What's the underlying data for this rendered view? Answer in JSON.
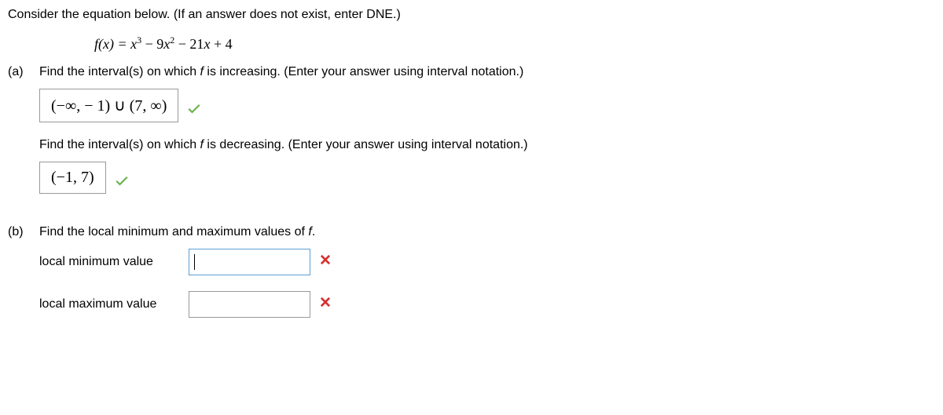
{
  "intro": "Consider the equation below. (If an answer does not exist, enter DNE.)",
  "equation": {
    "lhs": "f(x) = ",
    "rhs_html": "x<sup>3</sup> − 9x<sup>2</sup> − 21x + 4"
  },
  "parts": {
    "a": {
      "label": "(a)",
      "q1": "Find the interval(s) on which f is increasing. (Enter your answer using interval notation.)",
      "ans1": "(−∞, − 1) ∪ (7, ∞)",
      "q2": "Find the interval(s) on which f is decreasing. (Enter your answer using interval notation.)",
      "ans2": "(−1, 7)"
    },
    "b": {
      "label": "(b)",
      "q": "Find the local minimum and maximum values of f.",
      "min_label": "local minimum value",
      "min_value": "",
      "max_label": "local maximum value",
      "max_value": ""
    }
  }
}
